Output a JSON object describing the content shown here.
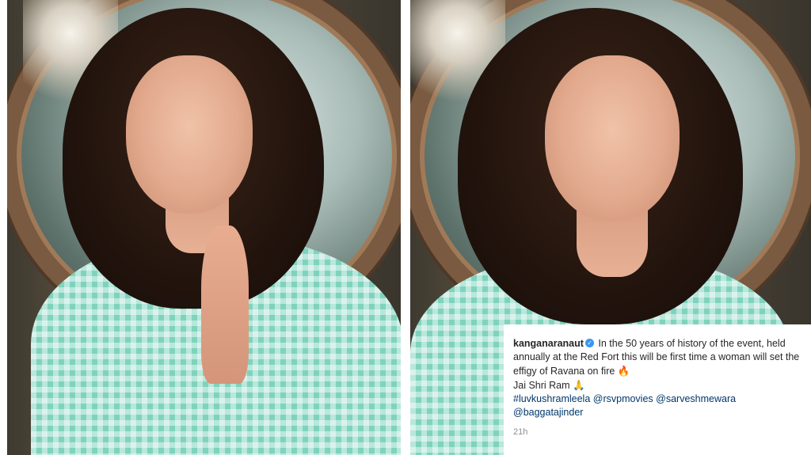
{
  "post": {
    "username": "kanganaranaut",
    "caption_text": "In the 50 years of history of the event, held annually at the Red Fort this will be first time a woman will set the effigy of Ravana on fire",
    "fire_emoji": "🔥",
    "line2": "Jai Shri Ram",
    "pray_emoji": "🙏",
    "tags": [
      "#luvkushramleela",
      "@rsvpmovies",
      "@sarveshmewara",
      "@baggatajinder"
    ],
    "timestamp": "21h"
  },
  "colors": {
    "verified_badge": "#3897f0",
    "tag_link": "#00376b",
    "timestamp": "#8e8e8e"
  },
  "icons": [
    "verified-badge-icon",
    "fire-emoji",
    "folded-hands-emoji"
  ]
}
